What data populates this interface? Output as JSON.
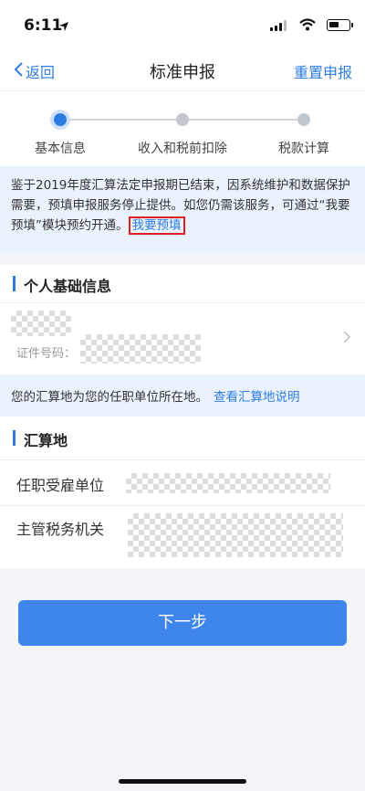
{
  "status_bar": {
    "time": "6:11"
  },
  "nav": {
    "back_label": "返回",
    "title": "标准申报",
    "reset_label": "重置申报"
  },
  "steps": [
    {
      "label": "基本信息",
      "active": true
    },
    {
      "label": "收入和税前扣除",
      "active": false
    },
    {
      "label": "税款计算",
      "active": false
    }
  ],
  "notice": {
    "text": "鉴于2019年度汇算法定申报期已结束，因系统维护和数据保护需要，预填申报服务停止提供。如您仍需该服务，可通过“我要预填”模块预约开通。",
    "link": "我要预填"
  },
  "personal": {
    "section_title": "个人基础信息",
    "id_label": "证件号码："
  },
  "location_note": {
    "text": "您的汇算地为您的任职单位所在地。",
    "link": "查看汇算地说明"
  },
  "settlement": {
    "section_title": "汇算地",
    "employer_label": "任职受雇单位",
    "tax_office_label": "主管税务机关"
  },
  "next_button": "下一步",
  "colors": {
    "accent": "#2f7de1",
    "button": "#3f86ec",
    "highlight_border": "#e02020"
  }
}
